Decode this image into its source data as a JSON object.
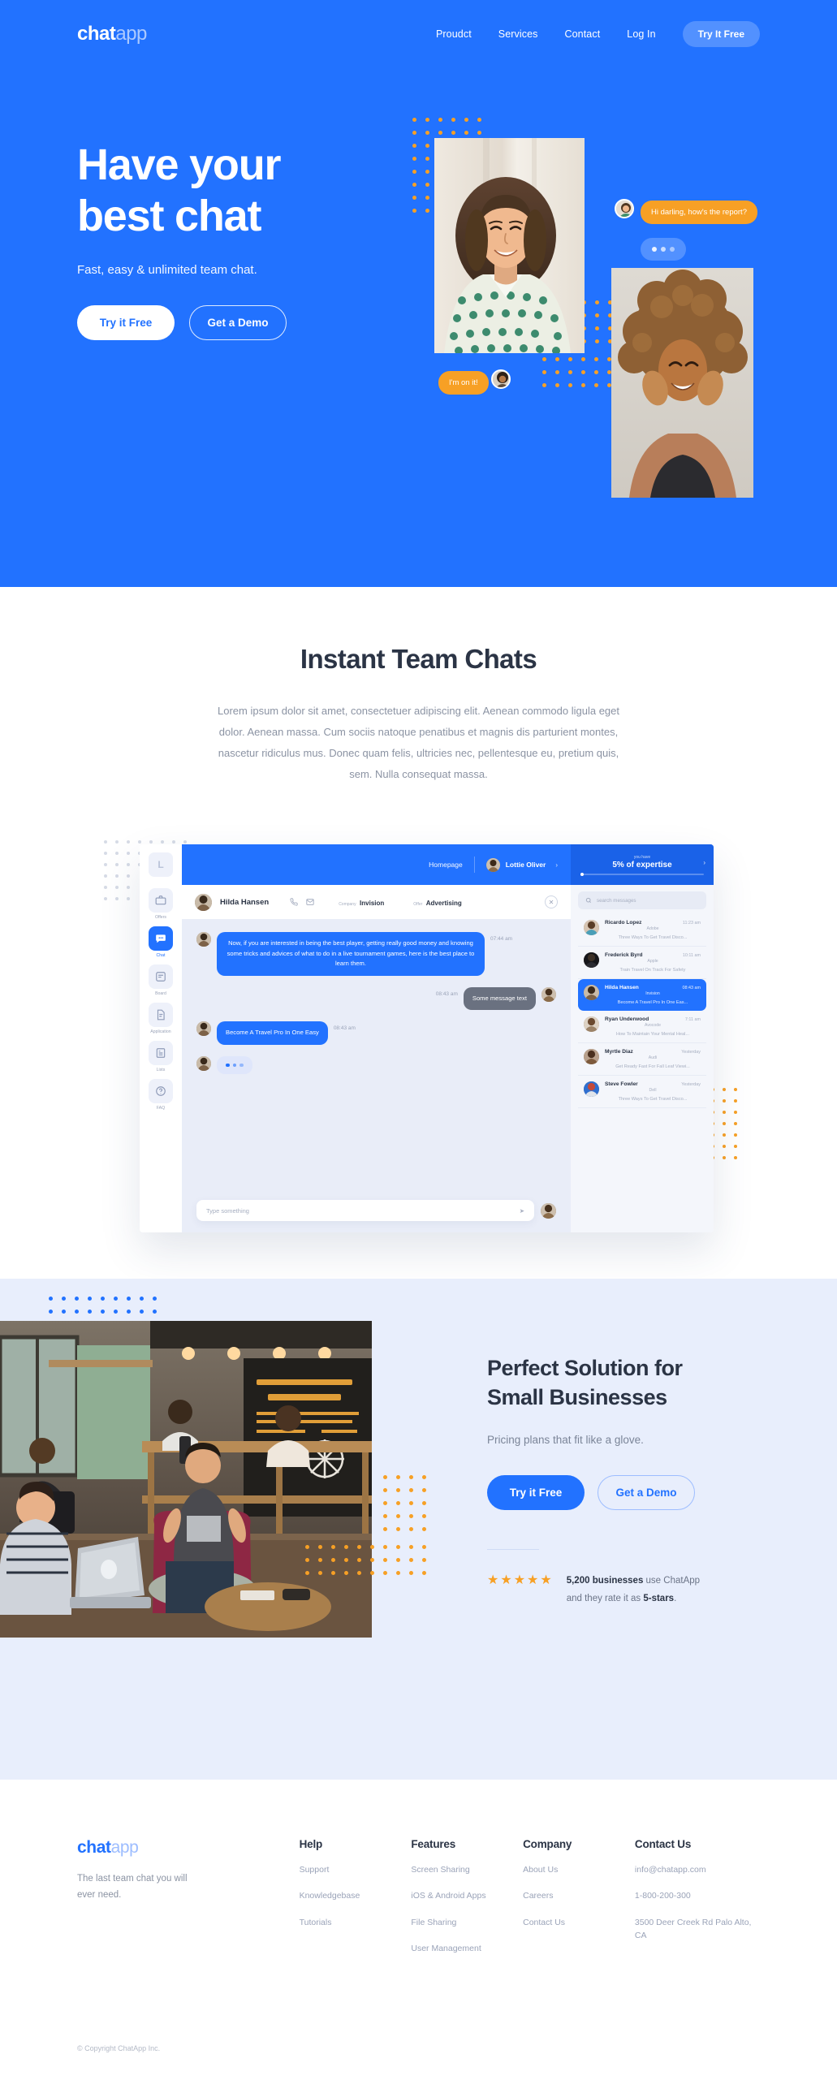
{
  "brand": {
    "part1": "chat",
    "part2": "app"
  },
  "nav": {
    "links": [
      {
        "label": "Proudct"
      },
      {
        "label": "Services"
      },
      {
        "label": "Contact"
      },
      {
        "label": "Log In"
      }
    ],
    "cta": "Try It Free"
  },
  "hero": {
    "heading_line1": "Have your",
    "heading_line2": "best chat",
    "subtitle": "Fast, easy & unlimited team chat.",
    "primary_button": "Try it Free",
    "secondary_button": "Get a Demo",
    "bubbles": {
      "incoming": "Hi darling, how's the report?",
      "outgoing": "I'm on it!"
    }
  },
  "team_section": {
    "title": "Instant Team Chats",
    "paragraph": "Lorem ipsum dolor sit amet, consectetuer adipiscing elit. Aenean commodo ligula eget dolor. Aenean massa. Cum sociis natoque penatibus et magnis dis parturient montes, nascetur ridiculus mus. Donec quam felis, ultricies nec, pellentesque eu, pretium quis, sem. Nulla consequat massa."
  },
  "app_mockup": {
    "sidebar": {
      "logo": "L",
      "items": [
        {
          "label": "Offers",
          "icon": "briefcase-icon",
          "active": false
        },
        {
          "label": "Chat",
          "icon": "chat-bubble-icon",
          "active": true
        },
        {
          "label": "Board",
          "icon": "board-icon",
          "active": false
        },
        {
          "label": "Application",
          "icon": "document-icon",
          "active": false
        },
        {
          "label": "Lists",
          "icon": "list-icon",
          "active": false
        },
        {
          "label": "FAQ",
          "icon": "question-mark-icon",
          "active": false
        }
      ]
    },
    "topbar": {
      "homepage": "Homepage",
      "user": "Lottie Oliver",
      "expertise_label": "you have",
      "expertise_value": "5% of expertise"
    },
    "chat_header": {
      "name": "Hilda Hansen",
      "company_label": "Company",
      "company_value": "Invision",
      "offer_label": "Offer",
      "offer_value": "Advertising"
    },
    "messages": [
      {
        "direction": "in",
        "text": "Now, if you are interested in being the best player, getting really good money and knowing some tricks and advices of what to do in a live tournament games, here is the best place to learn them.",
        "time": "07:44 am",
        "style": "blue"
      },
      {
        "direction": "out",
        "text": "Some message text",
        "time": "08:43 am",
        "style": "grey"
      },
      {
        "direction": "in",
        "text": "Become A Travel Pro In One Easy",
        "time": "08:43 am",
        "style": "blue"
      },
      {
        "direction": "in",
        "text": "",
        "time": "",
        "style": "typing"
      }
    ],
    "composer": {
      "placeholder": "Type something"
    },
    "list": {
      "search_placeholder": "search messages",
      "rows": [
        {
          "name": "Ricardo Lopez",
          "company": "Adobe",
          "time": "11:23 am",
          "preview": "Three Ways To Get Travel Disco...",
          "active": false
        },
        {
          "name": "Frederick Byrd",
          "company": "Apple",
          "time": "10:11 am",
          "preview": "Train Travel On Track For Safety",
          "active": false
        },
        {
          "name": "Hilda Hansen",
          "company": "Invision",
          "time": "08:43 am",
          "preview": "Become A Travel Pro In One Eas...",
          "active": true
        },
        {
          "name": "Ryan Underwood",
          "company": "Avocode",
          "time": "7:11 am",
          "preview": "How To Maintain Your Mental Heal...",
          "active": false
        },
        {
          "name": "Myrtle Diaz",
          "company": "Audi",
          "time": "Yesterday",
          "preview": "Get Ready Fast For Fall Leaf Viewi...",
          "active": false
        },
        {
          "name": "Steve Fowler",
          "company": "Dell",
          "time": "Yesterday",
          "preview": "Three Ways To Get Travel Disco...",
          "active": false
        }
      ]
    }
  },
  "small_business": {
    "heading_line1": "Perfect Solution for",
    "heading_line2": "Small Businesses",
    "subtitle": "Pricing plans that fit like a glove.",
    "primary_button": "Try it Free",
    "secondary_button": "Get a Demo",
    "stars": "★★★★★",
    "rating_line1_bold": "5,200 businesses",
    "rating_line1_rest": " use ChatApp",
    "rating_line2_pre": "and they rate it as ",
    "rating_line2_bold": "5-stars",
    "rating_line2_post": "."
  },
  "footer": {
    "tagline": "The last team chat you will ever need.",
    "columns": [
      {
        "title": "Help",
        "links": [
          "Support",
          "Knowledgebase",
          "Tutorials"
        ]
      },
      {
        "title": "Features",
        "links": [
          "Screen Sharing",
          "iOS & Android Apps",
          "File Sharing",
          "User Management"
        ]
      },
      {
        "title": "Company",
        "links": [
          "About Us",
          "Careers",
          "Contact Us"
        ]
      },
      {
        "title": "Contact Us",
        "links": [
          "info@chatapp.com",
          "1-800-200-300",
          "3500 Deer Creek Rd Palo Alto, CA"
        ]
      }
    ],
    "copyright": "© Copyright ChatApp Inc."
  },
  "colors": {
    "brand_blue": "#2272ff",
    "accent_orange": "#f7a025",
    "light_blue_bg": "#e8eefc",
    "heading": "#2b3445",
    "muted": "#8b93a3"
  }
}
